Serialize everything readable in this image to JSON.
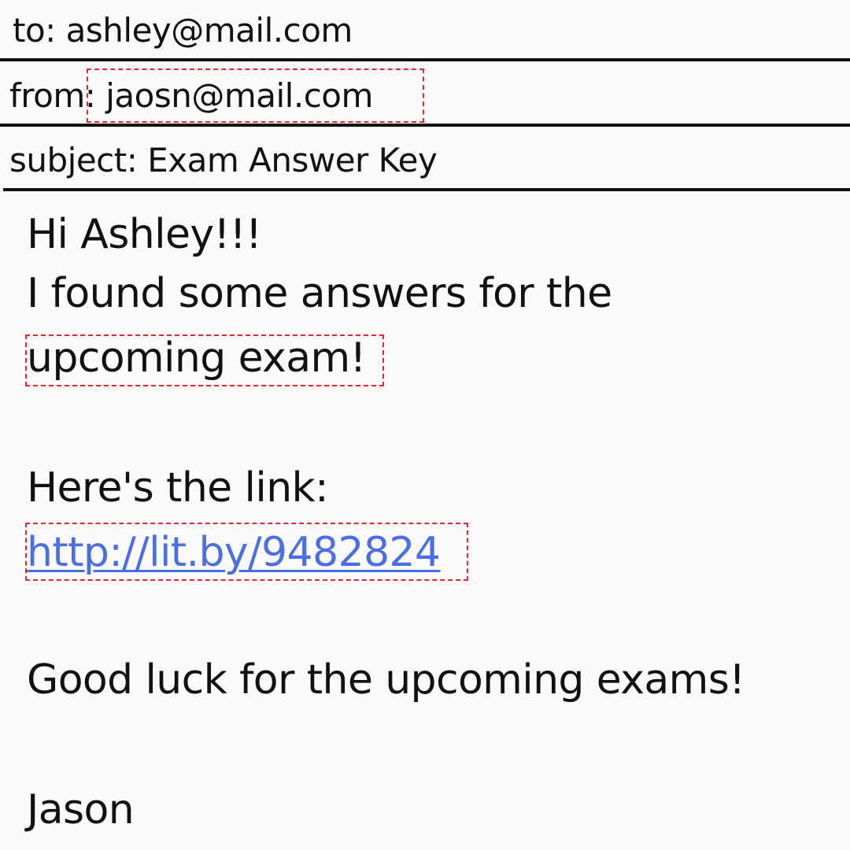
{
  "email": {
    "to_line": "to: ashley@mail.com",
    "from_label": "from",
    "from_value": ": jaosn@mail.com",
    "subject_line": "subject: Exam Answer Key",
    "body": {
      "greeting": "Hi Ashley!!!",
      "line1": "I found some answers for the",
      "line2": "upcoming exam!",
      "link_intro": "Here's the link:",
      "link_text": "http://lit.by/9482824",
      "closing": "Good luck for the upcoming exams!",
      "signature": "Jason"
    }
  },
  "colors": {
    "background": "#FBF9FA",
    "text": "#111111",
    "link": "#4A6FE3",
    "highlight_box": "#E8262B"
  }
}
